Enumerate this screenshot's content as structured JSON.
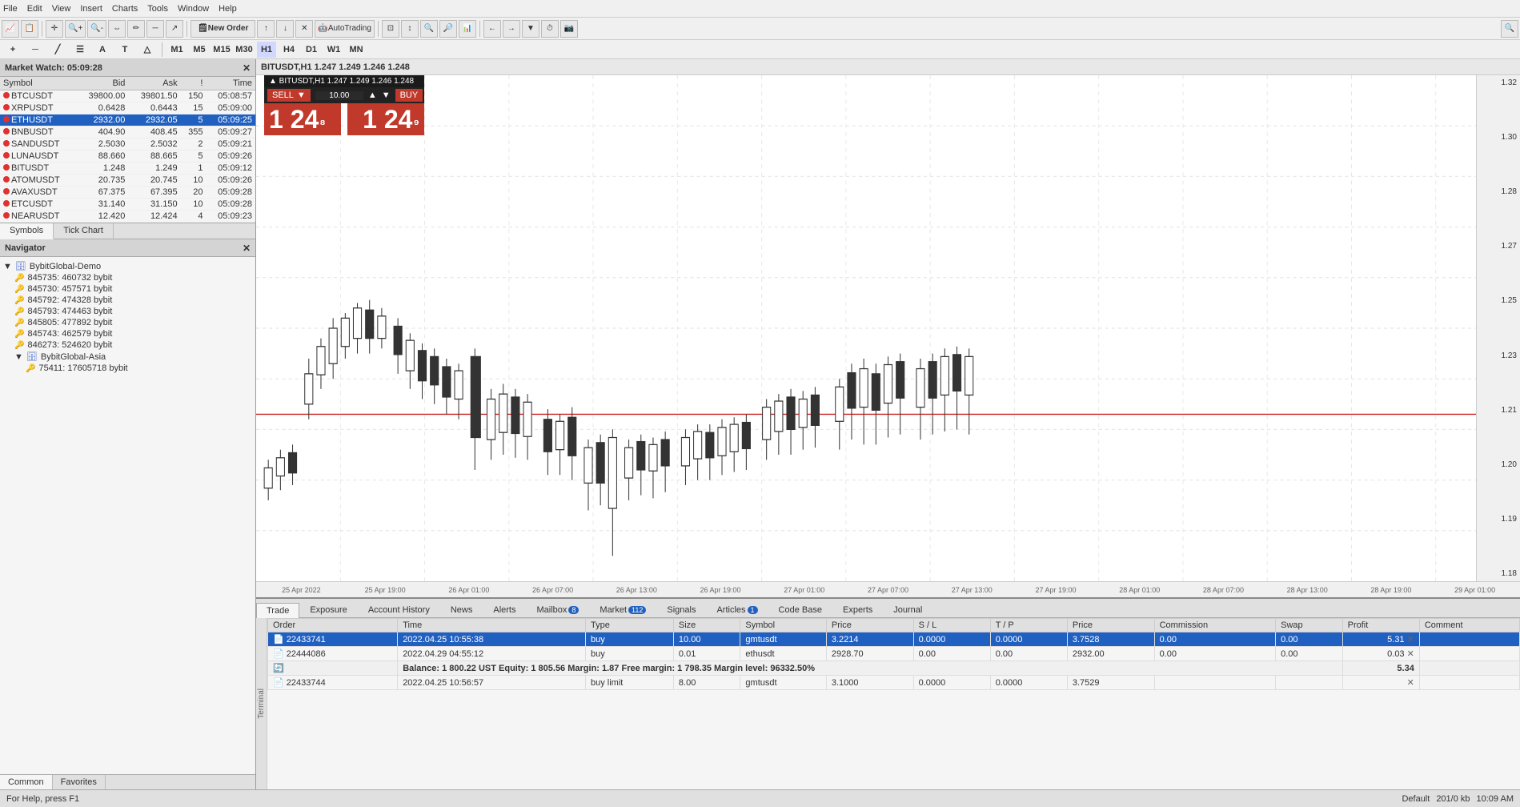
{
  "menuBar": {
    "items": [
      "File",
      "Edit",
      "View",
      "Insert",
      "Charts",
      "Tools",
      "Window",
      "Help"
    ]
  },
  "toolbar": {
    "newOrderLabel": "New Order",
    "autoTradingLabel": "AutoTrading",
    "searchIcon": "🔍"
  },
  "timeframes": {
    "groups": [
      "M1",
      "M5",
      "M15",
      "M30",
      "H1",
      "H4",
      "D1",
      "W1",
      "MN"
    ]
  },
  "marketWatch": {
    "title": "Market Watch: 05:09:28",
    "columns": [
      "Symbol",
      "Bid",
      "Ask",
      "!",
      "Time"
    ],
    "rows": [
      {
        "symbol": "BTCUSDT",
        "bid": "39800.00",
        "ask": "39801.50",
        "spread": "150",
        "time": "05:08:57"
      },
      {
        "symbol": "XRPUSDT",
        "bid": "0.6428",
        "ask": "0.6443",
        "spread": "15",
        "time": "05:09:00"
      },
      {
        "symbol": "ETHUSDT",
        "bid": "2932.00",
        "ask": "2932.05",
        "spread": "5",
        "time": "05:09:25",
        "selected": true
      },
      {
        "symbol": "BNBUSDT",
        "bid": "404.90",
        "ask": "408.45",
        "spread": "355",
        "time": "05:09:27"
      },
      {
        "symbol": "SANDUSDT",
        "bid": "2.5030",
        "ask": "2.5032",
        "spread": "2",
        "time": "05:09:21"
      },
      {
        "symbol": "LUNAUSDT",
        "bid": "88.660",
        "ask": "88.665",
        "spread": "5",
        "time": "05:09:26"
      },
      {
        "symbol": "BITUSDT",
        "bid": "1.248",
        "ask": "1.249",
        "spread": "1",
        "time": "05:09:12"
      },
      {
        "symbol": "ATOMUSDT",
        "bid": "20.735",
        "ask": "20.745",
        "spread": "10",
        "time": "05:09:26"
      },
      {
        "symbol": "AVAXUSDT",
        "bid": "67.375",
        "ask": "67.395",
        "spread": "20",
        "time": "05:09:28"
      },
      {
        "symbol": "ETCUSDT",
        "bid": "31.140",
        "ask": "31.150",
        "spread": "10",
        "time": "05:09:28"
      },
      {
        "symbol": "NEARUSDT",
        "bid": "12.420",
        "ask": "12.424",
        "spread": "4",
        "time": "05:09:23"
      }
    ],
    "tabs": [
      "Symbols",
      "Tick Chart"
    ]
  },
  "navigator": {
    "title": "Navigator",
    "tree": {
      "root": "BybitGlobal-Demo",
      "accounts": [
        "845735: 460732 bybit",
        "845730: 457571 bybit",
        "845792: 474328 bybit",
        "845793: 474463 bybit",
        "845805: 477892 bybit",
        "845743: 462579 bybit",
        "846273: 524620 bybit"
      ],
      "root2": "BybitGlobal-Asia",
      "accounts2": [
        "75411: 17605718 bybit"
      ]
    },
    "tabs": [
      "Common",
      "Favorites"
    ]
  },
  "chart": {
    "title": "BITUSDT,H1  1.247  1.249  1.246  1.248",
    "symbol": "BITUSDT,H1",
    "priceLabels": [
      "1.32",
      "1.30",
      "1.28",
      "1.27",
      "1.25",
      "1.23",
      "1.21",
      "1.20",
      "1.19",
      "1.18"
    ],
    "timeLabels": [
      "25 Apr 2022",
      "25 Apr 19:00",
      "26 Apr 01:00",
      "26 Apr 07:00",
      "26 Apr 13:00",
      "26 Apr 19:00",
      "27 Apr 01:00",
      "27 Apr 07:00",
      "27 Apr 13:00",
      "27 Apr 19:00",
      "28 Apr 01:00",
      "28 Apr 07:00",
      "28 Apr 13:00",
      "28 Apr 19:00",
      "29 Apr 01:00"
    ],
    "tradeWidget": {
      "symbolLine": "▲ BITUSDT,H1  1.247  1.249  1.246  1.248",
      "sellLabel": "SELL",
      "buyLabel": "BUY",
      "lotValue": "10.00",
      "sellBigPrice": "1 24",
      "sellSmallPrice": "8",
      "buyBigPrice": "1 24",
      "buySmallPrice": "9"
    }
  },
  "terminal": {
    "tabs": [
      {
        "label": "Trade",
        "badge": ""
      },
      {
        "label": "Exposure",
        "badge": ""
      },
      {
        "label": "Account History",
        "badge": ""
      },
      {
        "label": "News",
        "badge": ""
      },
      {
        "label": "Alerts",
        "badge": ""
      },
      {
        "label": "Mailbox",
        "badge": "8"
      },
      {
        "label": "Market",
        "badge": "112"
      },
      {
        "label": "Signals",
        "badge": ""
      },
      {
        "label": "Articles",
        "badge": "1"
      },
      {
        "label": "Code Base",
        "badge": ""
      },
      {
        "label": "Experts",
        "badge": ""
      },
      {
        "label": "Journal",
        "badge": ""
      }
    ],
    "tableHeaders": [
      "Order",
      "Time",
      "Type",
      "Size",
      "Symbol",
      "Price",
      "S / L",
      "T / P",
      "Price",
      "Commission",
      "Swap",
      "Profit",
      "Comment"
    ],
    "rows": [
      {
        "order": "22433741",
        "time": "2022.04.25 10:55:38",
        "type": "buy",
        "size": "10.00",
        "symbol": "gmtusdt",
        "price": "3.2214",
        "sl": "0.0000",
        "tp": "0.0000",
        "price2": "3.7528",
        "commission": "0.00",
        "swap": "0.00",
        "profit": "5.31",
        "selected": true
      },
      {
        "order": "22444086",
        "time": "2022.04.29 04:55:12",
        "type": "buy",
        "size": "0.01",
        "symbol": "ethusdt",
        "price": "2928.70",
        "sl": "0.00",
        "tp": "0.00",
        "price2": "2932.00",
        "commission": "0.00",
        "swap": "0.00",
        "profit": "0.03",
        "selected": false
      },
      {
        "order": "",
        "time": "",
        "type": "",
        "size": "",
        "symbol": "Balance: 1 800.22 UST  Equity: 1 805.56  Margin: 1.87  Free margin: 1 798.35  Margin level: 96332.50%",
        "price": "",
        "sl": "",
        "tp": "",
        "price2": "",
        "commission": "",
        "swap": "",
        "profit": "5.34",
        "isBalance": true
      },
      {
        "order": "22433744",
        "time": "2022.04.25 10:56:57",
        "type": "buy limit",
        "size": "8.00",
        "symbol": "gmtusdt",
        "price": "3.1000",
        "sl": "0.0000",
        "tp": "0.0000",
        "price2": "3.7529",
        "commission": "",
        "swap": "",
        "profit": "",
        "isPending": true
      }
    ]
  },
  "statusBar": {
    "helpText": "For Help, press F1",
    "defaultLabel": "Default",
    "barInfo": "201/0 kb",
    "time": "10:09 AM"
  }
}
